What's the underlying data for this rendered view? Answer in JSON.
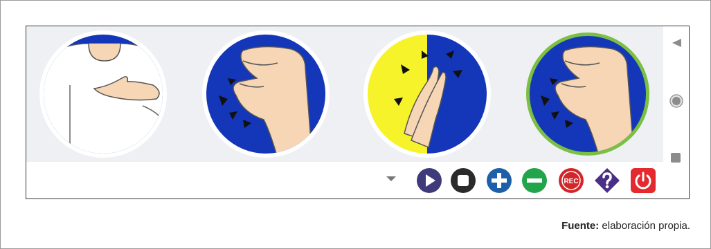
{
  "caption": {
    "label": "Fuente:",
    "text": "elaboración propia."
  },
  "signs": [
    {
      "icon": "person-chest-hand-icon",
      "selected": false
    },
    {
      "icon": "pinch-hand-icon",
      "selected": false
    },
    {
      "icon": "clapping-hands-icon",
      "selected": false
    },
    {
      "icon": "pinch-hand-icon",
      "selected": true
    }
  ],
  "nav": [
    {
      "icon": "back-triangle-icon"
    },
    {
      "icon": "home-circle-icon"
    },
    {
      "icon": "recent-square-icon"
    }
  ],
  "toolbar": {
    "dropdown_icon": "chevron-down-icon",
    "rec_label": "REC",
    "buttons": [
      {
        "icon": "play-icon",
        "color": "#3f3a7a"
      },
      {
        "icon": "stop-icon",
        "color": "#2b2b2b"
      },
      {
        "icon": "plus-icon",
        "color": "#1d5fa8"
      },
      {
        "icon": "minus-icon",
        "color": "#21a44a"
      },
      {
        "icon": "record-icon",
        "color": "#d3262a"
      },
      {
        "icon": "help-icon",
        "color": "#4a2f86"
      },
      {
        "icon": "power-icon",
        "color": "#e42a2f"
      }
    ]
  },
  "colors": {
    "blue": "#1436b8",
    "yellow": "#f7f32a",
    "skin": "#f6d6b4",
    "selected_ring": "#7bc043"
  }
}
